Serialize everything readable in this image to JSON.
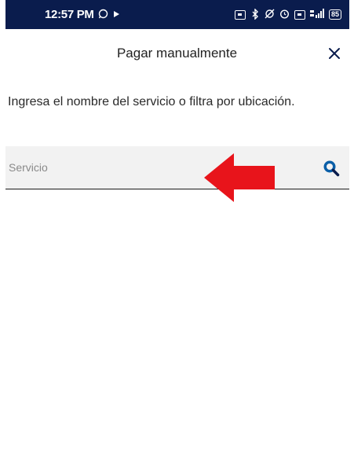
{
  "status_bar": {
    "time": "12:57 PM",
    "battery": "85",
    "signal": "4G"
  },
  "header": {
    "title": "Pagar manualmente"
  },
  "instructions": "Ingresa el nombre del servicio o filtra por ubicación.",
  "search": {
    "placeholder": "Servicio",
    "value": ""
  },
  "colors": {
    "status_bar_bg": "#0a1c4d",
    "accent": "#0a5fa8",
    "annotation": "#e8141b"
  }
}
